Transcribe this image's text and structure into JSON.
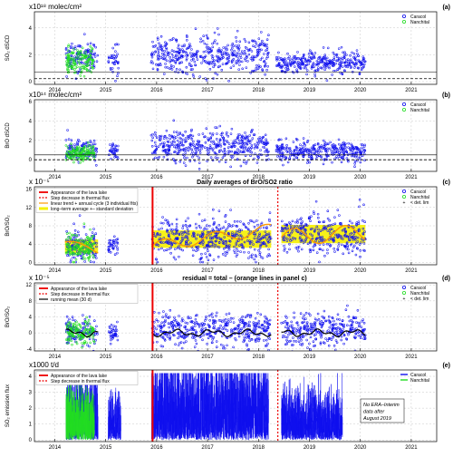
{
  "figure": {
    "x_ticks": [
      "2014",
      "2015",
      "2016",
      "2017",
      "2018",
      "2019",
      "2020",
      "2021"
    ],
    "colors": {
      "caracol": "#1010ee",
      "nanchital": "#22dd22",
      "red": "#ee0000",
      "yellow": "#f5f000",
      "orange": "#ff9900",
      "black": "#000000"
    }
  },
  "chart_data": [
    {
      "id": "a",
      "type": "scatter",
      "letter": "(a)",
      "unit": "x10¹⁸ molec/cm²",
      "ylabel": "SO₂ dSCD",
      "title": "",
      "xlim": [
        2013.6,
        2021.5
      ],
      "ylim": [
        -0.2,
        5.2
      ],
      "yticks": [
        "0",
        "2",
        "4"
      ],
      "legend": [
        "Caracol",
        "Nanchital"
      ],
      "ref_lines": [
        0.22,
        0.72
      ],
      "series": [
        {
          "name": "Caracol",
          "segments": [
            [
              2014.22,
              2014.85,
              1.9,
              0.55
            ],
            [
              2015.05,
              2015.25,
              1.6,
              0.5
            ],
            [
              2015.88,
              2018.2,
              2.0,
              0.7
            ],
            [
              2018.35,
              2018.95,
              1.4,
              0.4
            ],
            [
              2018.95,
              2020.1,
              1.45,
              0.35
            ]
          ]
        },
        {
          "name": "Nanchital",
          "segments": [
            [
              2014.22,
              2014.78,
              1.5,
              0.5
            ]
          ]
        }
      ]
    },
    {
      "id": "b",
      "type": "scatter",
      "letter": "(b)",
      "unit": "x10¹⁴ molec/cm²",
      "ylabel": "BrO dSCD",
      "title": "",
      "xlim": [
        2013.6,
        2021.5
      ],
      "ylim": [
        -1.2,
        6.2
      ],
      "yticks": [
        "0",
        "2",
        "4",
        "6"
      ],
      "legend": [
        "Caracol",
        "Nanchital"
      ],
      "ref_lines": [
        0.0,
        0.5
      ],
      "series": [
        {
          "name": "Caracol",
          "segments": [
            [
              2014.22,
              2014.85,
              1.0,
              0.6
            ],
            [
              2015.05,
              2015.25,
              0.9,
              0.5
            ],
            [
              2015.88,
              2018.2,
              1.5,
              0.8
            ],
            [
              2018.35,
              2020.1,
              0.9,
              0.5
            ]
          ]
        },
        {
          "name": "Nanchital",
          "segments": [
            [
              2014.22,
              2014.78,
              0.7,
              0.45
            ]
          ]
        }
      ]
    },
    {
      "id": "c",
      "type": "scatter",
      "letter": "(c)",
      "unit": "x 10⁻⁵",
      "ylabel": "BrO/SO₂",
      "title": "Daily averages of BrO/SO2 ratio",
      "xlim": [
        2013.6,
        2021.5
      ],
      "ylim": [
        -0.5,
        16.5
      ],
      "yticks": [
        "0",
        "4",
        "8",
        "12",
        "16"
      ],
      "legend": [
        "Caracol",
        "Nanchital",
        "< det. lim"
      ],
      "legend_left": [
        "Appearance of the lava lake",
        "Step decrease in thermal flux",
        "linear trend + annual cycle (3 individual fits)",
        "long–term average +– standard deviation"
      ],
      "vlines": {
        "lava_lake": 2015.92,
        "thermal_flux": 2018.38
      },
      "bands": [
        [
          2014.2,
          2014.85,
          2.0,
          5.0
        ],
        [
          2015.9,
          2018.25,
          3.2,
          7.0
        ],
        [
          2018.45,
          2020.1,
          4.2,
          8.2
        ]
      ],
      "series": [
        {
          "name": "Caracol",
          "segments": [
            [
              2014.22,
              2014.85,
              3.5,
              1.8
            ],
            [
              2015.05,
              2015.25,
              3.4,
              1.2
            ],
            [
              2015.9,
              2018.25,
              5.2,
              2.2
            ],
            [
              2018.45,
              2020.1,
              6.2,
              2.3
            ]
          ]
        },
        {
          "name": "Nanchital",
          "segments": [
            [
              2014.22,
              2014.78,
              3.0,
              1.5
            ]
          ]
        }
      ],
      "fit_segments": [
        {
          "x0": 2014.2,
          "x1": 2014.85,
          "base": 4.5,
          "slope": -3.0,
          "amp": 0.6
        },
        {
          "x0": 2015.9,
          "x1": 2018.25,
          "base": 3.5,
          "slope": 1.6,
          "amp": 1.2
        },
        {
          "x0": 2018.45,
          "x1": 2020.1,
          "base": 5.5,
          "slope": 0.6,
          "amp": 1.8
        }
      ]
    },
    {
      "id": "d",
      "type": "scatter",
      "letter": "(d)",
      "unit": "x 10⁻⁵",
      "ylabel": "BrO/SO₂",
      "title": "residual = total – (orange lines in panel c)",
      "xlim": [
        2013.6,
        2021.5
      ],
      "ylim": [
        -4.5,
        12.5
      ],
      "yticks": [
        "-4",
        "0",
        "4",
        "8",
        "12"
      ],
      "legend": [
        "Caracol",
        "Nanchital",
        "< det. lim"
      ],
      "legend_left": [
        "Appearance of the lava lake",
        "Step decrease in thermal flux",
        "running mean (30 d)"
      ],
      "vlines": {
        "lava_lake": 2015.92,
        "thermal_flux": 2018.38
      },
      "series": [
        {
          "name": "Caracol",
          "segments": [
            [
              2014.22,
              2014.85,
              0.3,
              1.6
            ],
            [
              2015.05,
              2015.25,
              0.2,
              1.2
            ],
            [
              2015.9,
              2018.25,
              0.8,
              2.0
            ],
            [
              2018.45,
              2020.1,
              0.6,
              2.1
            ]
          ]
        },
        {
          "name": "Nanchital",
          "segments": [
            [
              2014.22,
              2014.78,
              0.0,
              1.4
            ]
          ]
        }
      ]
    },
    {
      "id": "e",
      "type": "line",
      "letter": "(e)",
      "unit": "x1000 t/d",
      "ylabel": "SO₂ emission flux",
      "title": "",
      "xlim": [
        2013.6,
        2021.5
      ],
      "ylim": [
        -0.1,
        4.4
      ],
      "yticks": [
        "0",
        "1",
        "2",
        "3",
        "4"
      ],
      "legend": [
        "Caracol",
        "Nanchital"
      ],
      "legend_left": [
        "Appearance of the lava lake",
        "Step decrease in thermal flux"
      ],
      "vlines": {
        "lava_lake": 2015.92,
        "thermal_flux": 2018.38
      },
      "note": [
        "No ERA–Interim",
        "data after",
        "August 2019"
      ],
      "series": [
        {
          "name": "Caracol",
          "segments": [
            [
              2014.22,
              2014.85,
              1.6,
              1.4
            ],
            [
              2015.05,
              2015.3,
              1.2,
              1.0
            ],
            [
              2015.9,
              2018.2,
              1.8,
              1.8
            ],
            [
              2018.45,
              2019.65,
              1.2,
              1.1
            ]
          ]
        },
        {
          "name": "Nanchital",
          "segments": [
            [
              2014.22,
              2014.78,
              1.3,
              1.1
            ]
          ]
        }
      ]
    }
  ]
}
